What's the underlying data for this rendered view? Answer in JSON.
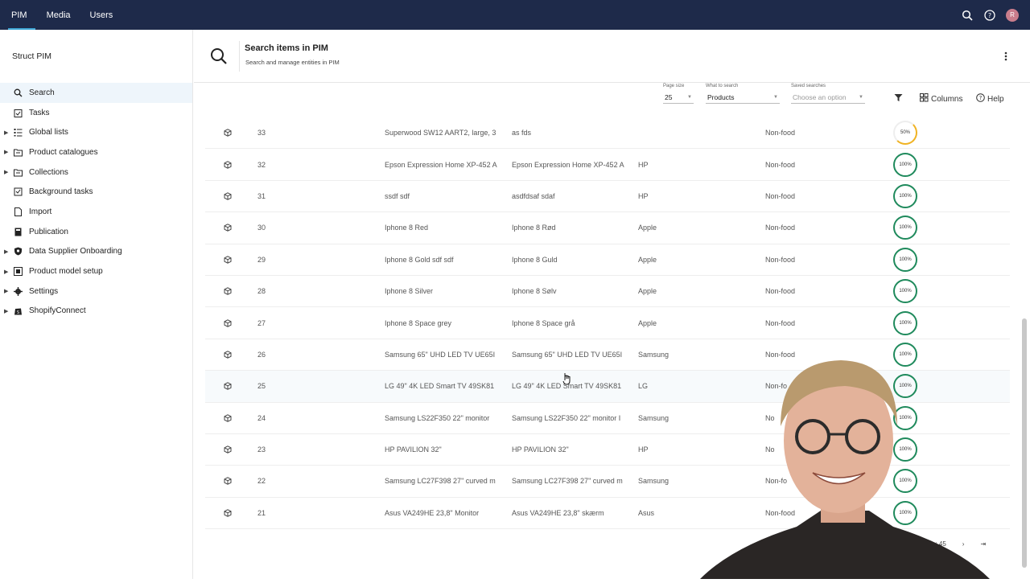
{
  "topbar": {
    "nav": [
      {
        "label": "PIM",
        "active": true
      },
      {
        "label": "Media",
        "active": false
      },
      {
        "label": "Users",
        "active": false
      }
    ],
    "avatar_initial": "R"
  },
  "sidebar": {
    "brand": "Struct PIM",
    "items": [
      {
        "label": "Search",
        "icon": "search-icon",
        "expandable": false,
        "active": true
      },
      {
        "label": "Tasks",
        "icon": "tasks-icon",
        "expandable": false
      },
      {
        "label": "Global lists",
        "icon": "list-icon",
        "expandable": true
      },
      {
        "label": "Product catalogues",
        "icon": "folder-icon",
        "expandable": true
      },
      {
        "label": "Collections",
        "icon": "folder-icon",
        "expandable": true
      },
      {
        "label": "Background tasks",
        "icon": "background-tasks-icon",
        "expandable": false
      },
      {
        "label": "Import",
        "icon": "import-icon",
        "expandable": false
      },
      {
        "label": "Publication",
        "icon": "publication-icon",
        "expandable": false
      },
      {
        "label": "Data Supplier Onboarding",
        "icon": "shield-icon",
        "expandable": true
      },
      {
        "label": "Product model setup",
        "icon": "model-icon",
        "expandable": true
      },
      {
        "label": "Settings",
        "icon": "gear-icon",
        "expandable": true
      },
      {
        "label": "ShopifyConnect",
        "icon": "shopify-icon",
        "expandable": true
      }
    ]
  },
  "header": {
    "title": "Search items in PIM",
    "subtitle": "Search and manage entities in PIM"
  },
  "toolbar": {
    "page_size_label": "Page size",
    "page_size_value": "25",
    "what_label": "What to search",
    "what_value": "Products",
    "saved_label": "Saved searches",
    "saved_placeholder": "Choose an option",
    "columns_label": "Columns",
    "help_label": "Help"
  },
  "rows": [
    {
      "id": "33",
      "name": "Superwood SW12 AART2, large, 3",
      "name2": "as fds",
      "brand": "",
      "category": "Non-food",
      "completeness": "50%"
    },
    {
      "id": "32",
      "name": "Epson Expression Home XP-452 A",
      "name2": "Epson Expression Home XP-452 A",
      "brand": "HP",
      "category": "Non-food",
      "completeness": "100%"
    },
    {
      "id": "31",
      "name": "ssdf sdf",
      "name2": "asdfdsaf sdaf",
      "brand": "HP",
      "category": "Non-food",
      "completeness": "100%"
    },
    {
      "id": "30",
      "name": "Iphone 8 Red",
      "name2": "Iphone 8 Rød",
      "brand": "Apple",
      "category": "Non-food",
      "completeness": "100%"
    },
    {
      "id": "29",
      "name": "Iphone 8 Gold sdf sdf",
      "name2": "Iphone 8 Guld",
      "brand": "Apple",
      "category": "Non-food",
      "completeness": "100%"
    },
    {
      "id": "28",
      "name": "Iphone 8 Silver",
      "name2": "Iphone 8 Sølv",
      "brand": "Apple",
      "category": "Non-food",
      "completeness": "100%"
    },
    {
      "id": "27",
      "name": "Iphone 8 Space grey",
      "name2": "Iphone 8 Space grå",
      "brand": "Apple",
      "category": "Non-food",
      "completeness": "100%"
    },
    {
      "id": "26",
      "name": "Samsung 65\" UHD LED TV UE65I",
      "name2": "Samsung 65\" UHD LED TV UE65I",
      "brand": "Samsung",
      "category": "Non-food",
      "completeness": "100%"
    },
    {
      "id": "25",
      "name": "LG 49\" 4K LED Smart TV 49SK81",
      "name2": "LG 49\" 4K LED Smart TV 49SK81",
      "brand": "LG",
      "category": "Non-fo",
      "completeness": "100%"
    },
    {
      "id": "24",
      "name": "Samsung LS22F350 22\" monitor",
      "name2": "Samsung LS22F350 22\" monitor I",
      "brand": "Samsung",
      "category": "No",
      "completeness": "100%"
    },
    {
      "id": "23",
      "name": "HP PAVILION 32\"",
      "name2": "HP PAVILION 32\"",
      "brand": "HP",
      "category": "No",
      "completeness": "100%"
    },
    {
      "id": "22",
      "name": "Samsung LC27F398 27\" curved m",
      "name2": "Samsung LC27F398 27\" curved m",
      "brand": "Samsung",
      "category": "Non-fo",
      "completeness": "100%"
    },
    {
      "id": "21",
      "name": "Asus VA249HE 23,8\" Monitor",
      "name2": "Asus VA249HE 23,8\" skærm",
      "brand": "Asus",
      "category": "Non-food",
      "completeness": "100%"
    }
  ],
  "footer": {
    "hits_text": "hits: 45"
  }
}
